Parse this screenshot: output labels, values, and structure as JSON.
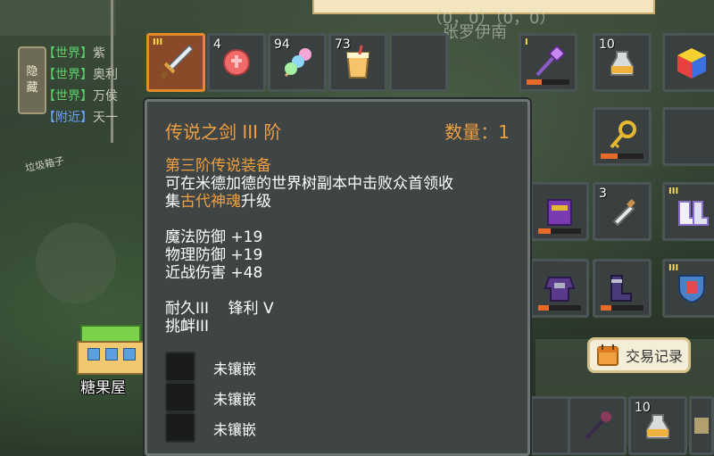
{
  "background": {
    "banner_title": "（0，0）（0，0）",
    "banner_name": "张罗伊南"
  },
  "chat": {
    "hide_label": [
      "隐",
      "藏"
    ],
    "lines": [
      {
        "channel": "【世界】",
        "text": "紫",
        "type": "world"
      },
      {
        "channel": "【世界】",
        "text": "奥利",
        "type": "world"
      },
      {
        "channel": "【世界】",
        "text": "万侯",
        "type": "world"
      },
      {
        "channel": "【附近】",
        "text": "天一",
        "type": "near"
      }
    ],
    "trash_label": "垃圾箱子"
  },
  "map": {
    "candy_house_label": "糖果屋"
  },
  "inventory": {
    "top_row": [
      {
        "icon": "legendary-sword-icon",
        "tier": "III",
        "selected": true
      },
      {
        "icon": "red-meat-icon",
        "count": "4"
      },
      {
        "icon": "candy-skewer-icon",
        "count": "94"
      },
      {
        "icon": "juice-drink-icon",
        "count": "73"
      },
      {
        "icon": "empty-slot"
      },
      {
        "icon": "magic-staff-icon",
        "tier": "I",
        "durability": 0.35
      },
      {
        "icon": "sling-bottle-icon",
        "count": "10"
      },
      {
        "icon": "color-cube-icon"
      }
    ],
    "right_items": [
      {
        "icon": "golden-key-icon",
        "durability": 0.4
      },
      {
        "icon": "purple-book-icon",
        "durability": 0.3
      },
      {
        "icon": "potion-bottle-icon",
        "count": "3"
      },
      {
        "icon": "white-boots-icon",
        "tier": "III"
      },
      {
        "icon": "purple-armor-icon",
        "durability": 0.25
      },
      {
        "icon": "purple-boots-icon",
        "durability": 0.25
      },
      {
        "icon": "shield-emblem-icon",
        "tier": "III"
      },
      {
        "icon": "dark-staff-icon"
      },
      {
        "icon": "sling-bottle-icon",
        "count": "10"
      },
      {
        "icon": "gear-item-icon"
      }
    ]
  },
  "tooltip": {
    "title": "传说之剑 III 阶",
    "quantity": "数量：1",
    "subtitle": "第三阶传说装备",
    "desc_1": "可在米德加德的世界树副本中击败众首领收",
    "desc_2a": "集",
    "desc_2b": "古代神魂",
    "desc_2c": "升级",
    "stats": [
      "魔法防御 +19",
      "物理防御 +19",
      "近战伤害 +48"
    ],
    "enchant_1": "耐久III    锋利 V",
    "enchant_2": "挑衅III",
    "sockets": [
      "未镶嵌",
      "未镶嵌",
      "未镶嵌"
    ]
  },
  "trade_button": {
    "label": "交易记录"
  },
  "colors": {
    "accent": "#f0a040",
    "selected_slot": "#e48a2a",
    "chat_world": "#5fd06a",
    "chat_near": "#6aa4ff"
  }
}
